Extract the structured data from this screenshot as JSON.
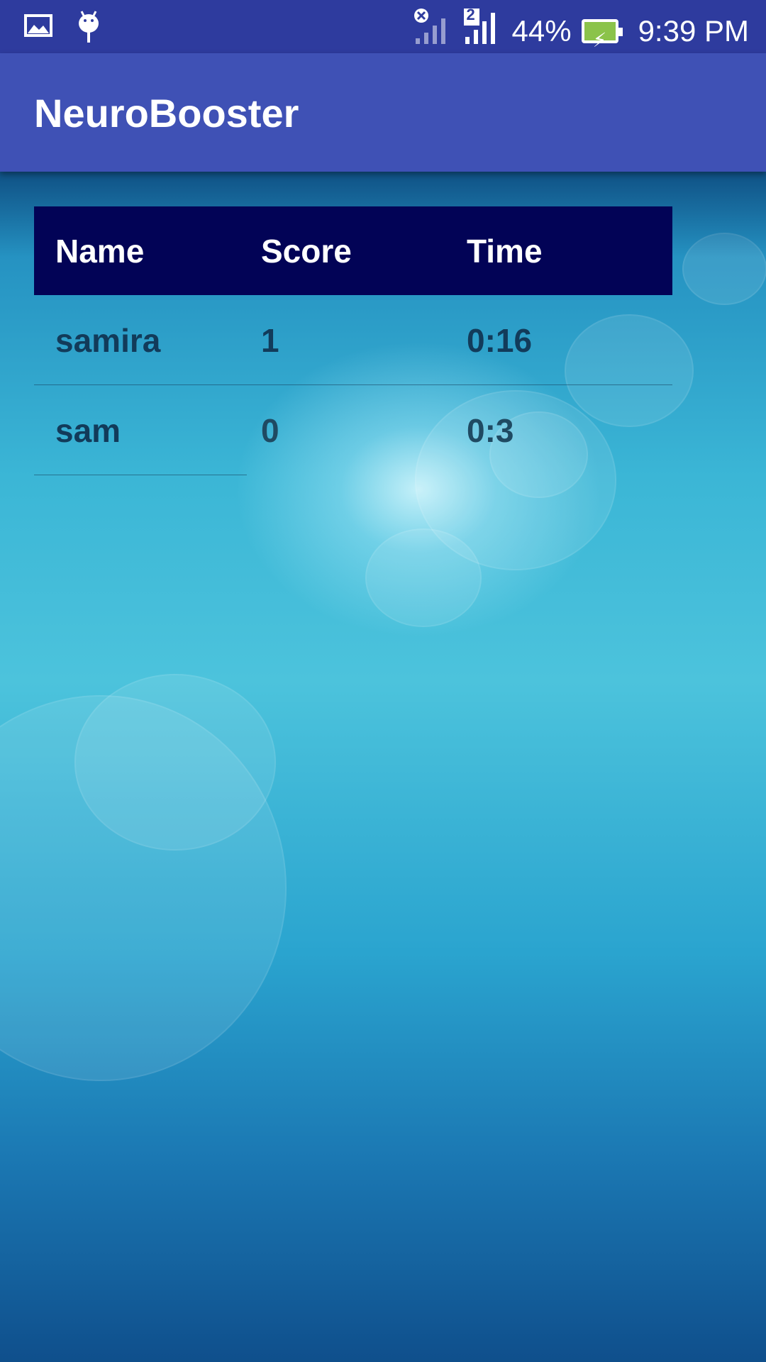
{
  "status_bar": {
    "battery": "44%",
    "time": "9:39 PM",
    "sim_badge": "2",
    "icons": [
      "image-icon",
      "android-debug-icon",
      "signal-off-icon",
      "signal-icon",
      "battery-charging-icon"
    ]
  },
  "app_bar": {
    "title": "NeuroBooster"
  },
  "table": {
    "headers": [
      "Name",
      "Score",
      "Time"
    ],
    "rows": [
      [
        "samira",
        "1",
        "0:16"
      ],
      [
        "sam",
        "0",
        "0:3"
      ]
    ]
  },
  "colors": {
    "status_bar": "#2e3b9e",
    "app_bar": "#3f51b5",
    "table_header": "#020356",
    "row_text": "#123b5a"
  }
}
